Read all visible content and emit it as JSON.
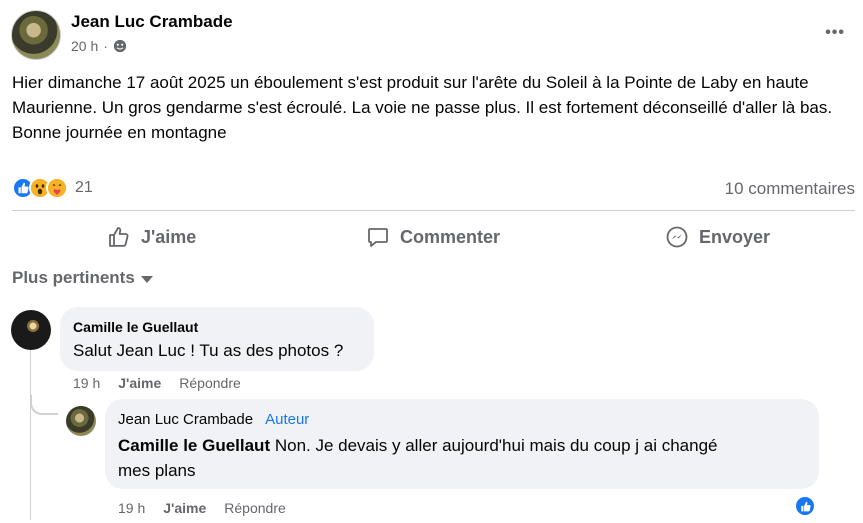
{
  "post": {
    "author": "Jean Luc Crambade",
    "time": "20 h",
    "separator": "·",
    "more_label": "•••",
    "text_paragraph_1": "Hier dimanche 17 août 2025 un éboulement s'est produit sur l'arête du Soleil à la Pointe de Laby en haute Maurienne. Un gros gendarme s'est écroulé. La voie ne passe plus. Il est fortement déconseillé d'aller là bas.",
    "text_paragraph_2": "Bonne journée en montagne",
    "reaction_count": "21",
    "comments_count": "10 commentaires",
    "reaction_icons": [
      "like-icon",
      "wow-icon",
      "care-icon"
    ]
  },
  "actions": {
    "like": "J'aime",
    "comment": "Commenter",
    "send": "Envoyer"
  },
  "sort_label": "Plus pertinents",
  "comments": [
    {
      "author": "Camille le Guellaut",
      "text": "Salut Jean Luc ! Tu as des photos ?",
      "time": "19 h",
      "like": "J'aime",
      "reply": "Répondre"
    },
    {
      "author": "Jean Luc Crambade",
      "badge": "Auteur",
      "mention": "Camille le Guellaut",
      "text_line_1": " Non. Je devais y aller aujourd'hui mais du coup j ai changé",
      "text_line_2": "mes plans",
      "time": "19 h",
      "like": "J'aime",
      "reply": "Répondre",
      "reaction_icon": "like-icon"
    }
  ],
  "colors": {
    "accent": "#1877f2",
    "secondary_text": "#65676b",
    "bubble": "#f0f2f5",
    "divider": "#ced0d4"
  }
}
